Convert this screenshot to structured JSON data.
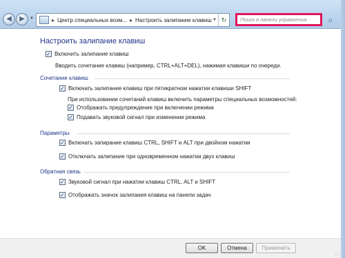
{
  "nav": {
    "back_icon": "arrow-left-icon",
    "forward_icon": "arrow-right-icon",
    "breadcrumb": [
      "Центр специальных возм...",
      "Настроить залипание клавиш"
    ],
    "separator": "▸",
    "refresh_icon": "refresh-icon"
  },
  "search": {
    "placeholder": "Поиск в панели управления",
    "highlight_color": "#e0155a"
  },
  "page": {
    "title": "Настроить залипание клавиш",
    "enable_label": "Включить залипание клавиш",
    "enable_checked": true,
    "enable_hint": "Вводить сочетание клавиш (например, CTRL+ALT+DEL), нажимая клавиши по очереди."
  },
  "sections": {
    "shortcut": {
      "title": "Сочетание клавиш",
      "shift5_label": "Включать залипание клавиш при пятикратном нажатии клавиши SHIFT",
      "shift5_checked": true,
      "sub_hint": "При использовании сочетаний клавиш включить параметры специальных возможностей:",
      "warning_label": "Отображать предупреждение при включении режима",
      "warning_checked": true,
      "sound_label": "Подавать звуковой сигнал при изменении режима",
      "sound_checked": true
    },
    "params": {
      "title": "Параметры",
      "lock_label": "Включать запирание клавиш CTRL, SHIFT и ALT при двойном нажатии",
      "lock_checked": true,
      "disable_label": "Отключать залипание при одновременном нажатии двух клавиш",
      "disable_checked": true
    },
    "feedback": {
      "title": "Обратная связь",
      "beep_label": "Звуковой сигнал при нажатии клавиш CTRL, ALT и SHIFT",
      "beep_checked": true,
      "icon_label": "Отображать значок залипания клавиш на панели задач",
      "icon_checked": true
    }
  },
  "footer": {
    "ok": "OK",
    "cancel": "Отмена",
    "apply": "Применить"
  },
  "colors": {
    "accent_text": "#1e3287"
  }
}
